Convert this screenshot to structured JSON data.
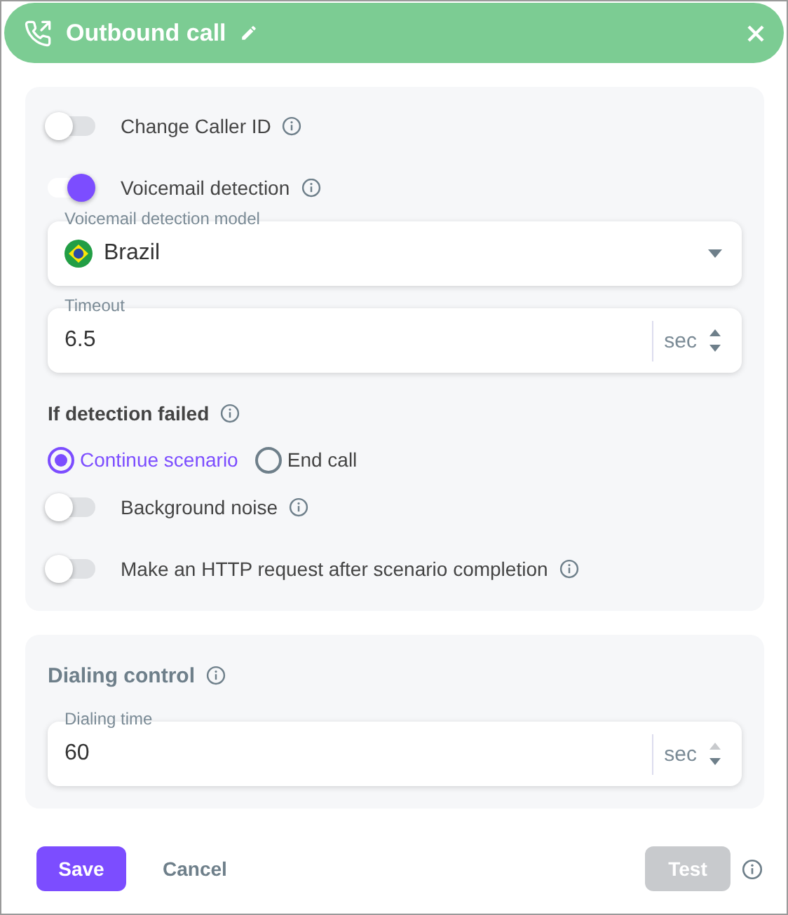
{
  "header": {
    "title": "Outbound call"
  },
  "panel": {
    "items": [
      {
        "kind": "toggle",
        "label": "Change Caller ID",
        "on": false
      },
      {
        "kind": "toggle",
        "label": "Voicemail detection",
        "on": true
      },
      {
        "kind": "select",
        "label": "Voicemail detection model",
        "value": "Brazil"
      },
      {
        "kind": "number",
        "label": "Timeout",
        "value": "6.5",
        "unit": "sec",
        "up_disabled": false
      },
      {
        "kind": "heading",
        "label": "If detection failed"
      },
      {
        "kind": "radios",
        "options": [
          {
            "label": "Continue scenario",
            "selected": true
          },
          {
            "label": "End call",
            "selected": false
          }
        ]
      },
      {
        "kind": "toggle",
        "label": "Background noise",
        "on": false
      },
      {
        "kind": "toggle",
        "label": "Make an HTTP request after scenario completion",
        "on": false
      }
    ]
  },
  "dialing": {
    "title": "Dialing control",
    "field": {
      "label": "Dialing time",
      "value": "60",
      "unit": "sec",
      "up_disabled": true
    }
  },
  "footer": {
    "save": "Save",
    "cancel": "Cancel",
    "test": {
      "label": "Test",
      "disabled": true
    }
  }
}
